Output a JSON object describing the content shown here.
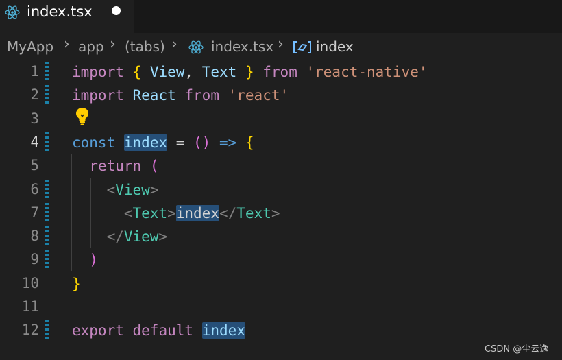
{
  "tab": {
    "label": "index.tsx",
    "icon": "react-icon",
    "modified": true
  },
  "breadcrumb": {
    "items": [
      "MyApp",
      "app",
      "(tabs)",
      "index.tsx",
      "index"
    ],
    "icons": [
      "react-icon",
      "symbol-variable-icon"
    ]
  },
  "editor": {
    "line_numbers": [
      "1",
      "2",
      "3",
      "4",
      "5",
      "6",
      "7",
      "8",
      "9",
      "10",
      "11",
      "12"
    ],
    "active_line": "4",
    "lines": [
      [
        [
          "import",
          "kw"
        ],
        [
          " ",
          "plain"
        ],
        [
          "{",
          "br1"
        ],
        [
          " ",
          "plain"
        ],
        [
          "View",
          "id"
        ],
        [
          ",",
          "plain"
        ],
        [
          " ",
          "plain"
        ],
        [
          "Text",
          "id"
        ],
        [
          " ",
          "plain"
        ],
        [
          "}",
          "br1"
        ],
        [
          " ",
          "plain"
        ],
        [
          "from",
          "kw"
        ],
        [
          " ",
          "plain"
        ],
        [
          "'react-native'",
          "str"
        ]
      ],
      [
        [
          "import",
          "kw"
        ],
        [
          " ",
          "plain"
        ],
        [
          "React",
          "id"
        ],
        [
          " ",
          "plain"
        ],
        [
          "from",
          "kw"
        ],
        [
          " ",
          "plain"
        ],
        [
          "'react'",
          "str"
        ]
      ],
      [],
      [
        [
          "const",
          "kwb"
        ],
        [
          " ",
          "plain"
        ],
        [
          "index",
          "id hl"
        ],
        [
          " = ",
          "plain"
        ],
        [
          "()",
          "br2"
        ],
        [
          " ",
          "plain"
        ],
        [
          "=>",
          "kwb"
        ],
        [
          " ",
          "plain"
        ],
        [
          "{",
          "br1"
        ]
      ],
      [
        [
          "  ",
          "plain"
        ],
        [
          "return",
          "kw"
        ],
        [
          " ",
          "plain"
        ],
        [
          "(",
          "br2"
        ]
      ],
      [
        [
          "    ",
          "plain"
        ],
        [
          "<",
          "tagp"
        ],
        [
          "View",
          "typ"
        ],
        [
          ">",
          "tagp"
        ]
      ],
      [
        [
          "      ",
          "plain"
        ],
        [
          "<",
          "tagp"
        ],
        [
          "Text",
          "typ"
        ],
        [
          ">",
          "tagp"
        ],
        [
          "index",
          "plain hl"
        ],
        [
          "</",
          "tagp"
        ],
        [
          "Text",
          "typ"
        ],
        [
          ">",
          "tagp"
        ]
      ],
      [
        [
          "    ",
          "plain"
        ],
        [
          "</",
          "tagp"
        ],
        [
          "View",
          "typ"
        ],
        [
          ">",
          "tagp"
        ]
      ],
      [
        [
          "  ",
          "plain"
        ],
        [
          ")",
          "br2"
        ]
      ],
      [
        [
          "}",
          "br1"
        ]
      ],
      [],
      [
        [
          "export",
          "kw"
        ],
        [
          " ",
          "plain"
        ],
        [
          "default",
          "kw"
        ],
        [
          " ",
          "plain"
        ],
        [
          "index",
          "id hl"
        ]
      ]
    ]
  },
  "watermark": "CSDN @尘云逸",
  "colors": {
    "background": "#1f1f1f",
    "keyword": "#c586c0",
    "type": "#4ec9b0",
    "string": "#ce9178",
    "highlight": "#264f78"
  }
}
